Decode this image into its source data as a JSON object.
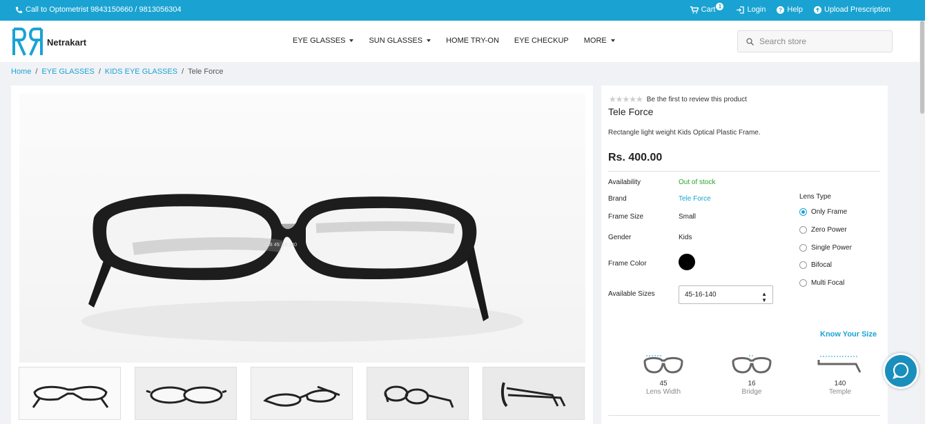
{
  "topbar": {
    "call_text": "Call to Optometrist 9843150660 / 9813056304",
    "cart_label": "Cart",
    "cart_count": "1",
    "login_label": "Login",
    "help_label": "Help",
    "upload_label": "Upload Prescription"
  },
  "header": {
    "logo_text": "Netrakart",
    "nav": [
      "EYE GLASSES",
      "SUN GLASSES",
      "HOME TRY-ON",
      "EYE CHECKUP",
      "MORE"
    ],
    "search_placeholder": "Search store"
  },
  "breadcrumb": [
    "Home",
    "EYE GLASSES",
    "KIDS EYE GLASSES",
    "Tele Force"
  ],
  "product": {
    "review_text": "Be the first to review this product",
    "stars": 0,
    "name": "Tele Force",
    "description": "Rectangle light weight Kids Optical Plastic Frame.",
    "price": "Rs. 400.00",
    "specs": {
      "availability_label": "Availability",
      "availability_value": "Out of stock",
      "brand_label": "Brand",
      "brand_value": "Tele Force",
      "frame_size_label": "Frame Size",
      "frame_size_value": "Small",
      "gender_label": "Gender",
      "gender_value": "Kids",
      "frame_color_label": "Frame Color",
      "frame_color": "#000000",
      "sizes_label": "Available Sizes",
      "selected_size": "45-16-140"
    },
    "lens_type": {
      "title": "Lens Type",
      "options": [
        "Only Frame",
        "Zero Power",
        "Single Power",
        "Bifocal",
        "Multi Focal"
      ],
      "selected": "Only Frame"
    },
    "know_size_label": "Know Your Size",
    "measurements": [
      {
        "value": "45",
        "label": "Lens Width"
      },
      {
        "value": "16",
        "label": "Bridge"
      },
      {
        "value": "140",
        "label": "Temple"
      }
    ],
    "frame_print": "238 45□16 140"
  },
  "colors": {
    "accent": "#1aa3d2",
    "in_stock_text": "#29a32a"
  }
}
